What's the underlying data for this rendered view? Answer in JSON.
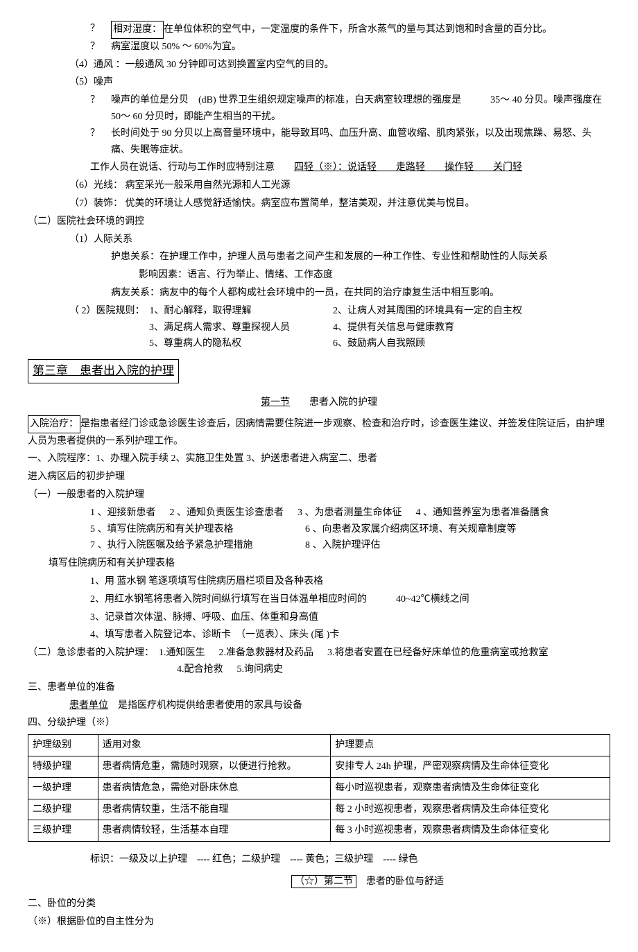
{
  "l1": {
    "q": "？",
    "label": "相对湿度：",
    "text": "在单位体积的空气中，一定温度的条件下，所含水蒸气的量与其达到饱和时含量的百分比。"
  },
  "l2": {
    "q": "？",
    "text": "病室湿度以 50% ～ 60%为宜。"
  },
  "l3": "（4）通风 ：一般通风 30 分钟即可达到换置室内空气的目的。",
  "l4": "（5）噪声",
  "l5": {
    "q": "？",
    "text": "噪声的单位是分贝　(dB) 世界卫生组织规定噪声的标准，白天病室较理想的强度是　　　35～ 40 分贝。噪声强度在 50～ 60 分贝时，即能产生相当的干扰。"
  },
  "l6": {
    "q": "？",
    "text": "长时间处于 90 分贝以上高音量环境中，能导致耳鸣、血压升高、血管收缩、肌肉紧张，以及出现焦躁、易怒、头痛、失眠等症状。"
  },
  "l7a": "工作人员在说话、行动与工作时应特别注意",
  "l7b": "四轻（※）：说话轻　　走路轻　　操作轻　　关门轻",
  "l8": "（6）光线：  病室采光一般采用自然光源和人工光源",
  "l9": "（7）装饰：  优美的环境让人感觉舒适愉快。病室应布置简单，整洁美观，并注意优美与悦目。",
  "l10": "（二）医院社会环境的调控",
  "l11": "（1）人际关系",
  "l12": "护患关系：在护理工作中，护理人员与患者之间产生和发展的一种工作性、专业性和帮助性的人际关系",
  "l13": "影响因素：语言、行为举止、情绪、工作态度",
  "l14": "病友关系：病友中的每个人都构成社会环境中的一员，在共同的治疗康复生活中相互影响。",
  "l15a": "（ 2）医院规则：　1、耐心解释，取得理解",
  "l15b": "2、让病人对其周围的环境具有一定的自主权",
  "l16a": "3、满足病人需求、尊重探视人员",
  "l16b": "4、提供有关信息与健康教育",
  "l17a": "5、尊重病人的隐私权",
  "l17b": "6、鼓励病人自我照顾",
  "chapter3": "第三章　患者出入院的护理",
  "sec1a": "第一节",
  "sec1b": "患者入院的护理",
  "l18a": "入院治疗：",
  "l18b": "是指患者经门诊或急诊医生诊查后，因病情需要住院进一步观察、检查和治疗时，诊查医生建议、并签发住院证后，由护理人员为患者提供的一系列护理工作。",
  "l19": "一、入院程序：1、办理入院手续 2、实施卫生处置 3、护送患者进入病室二、患者",
  "l19b": "进入病区后的初步护理",
  "l20": "（一）一般患者的入院护理",
  "l21": {
    "a": "1 、迎接新患者",
    "b": "2 、通知负责医生诊查患者",
    "c": "3 、为患者测量生命体征",
    "d": "4 、通知营养室为患者准备膳食"
  },
  "l22": {
    "a": "5 、填写住院病历和有关护理表格",
    "b": "6 、向患者及家属介绍病区环境、有关规章制度等"
  },
  "l23": {
    "a": "7 、执行入院医嘱及给予紧急护理措施",
    "b": "8 、入院护理评估"
  },
  "l24": "填写住院病历和有关护理表格",
  "l25": "1、用 蓝水钢 笔逐项填写住院病历眉栏项目及各种表格",
  "l26": "2、用红水钢笔将患者入院时间纵行填写在当日体温单相应时间的　　　40~42℃横线之间",
  "l27": "3、记录首次体温、脉搏、呼吸、血压、体重和身高值",
  "l28": "4、填写患者入院登记本、诊断卡　（一览表）、床头 (尾 )卡",
  "l29": {
    "a": "（二）急诊患者的入院护理：　1.通知医生",
    "b": "2.准备急救器材及药品",
    "c": "3.将患者安置在已经备好床单位的危重病室或抢救室"
  },
  "l30": {
    "a": "4.配合抢救",
    "b": "5.询问病史"
  },
  "l31": "三、患者单位的准备",
  "l32a": "患者单位",
  "l32b": "　是指医疗机构提供给患者使用的家具与设备",
  "l33": "四、分级护理（※）",
  "table": {
    "h1": "护理级别",
    "h2": "适用对象",
    "h3": "护理要点",
    "r1": {
      "c1": "特级护理",
      "c2": "患者病情危重，需随时观察，以便进行抢救。",
      "c3": "安排专人 24h 护理，严密观察病情及生命体征变化"
    },
    "r2": {
      "c1": "一级护理",
      "c2": "患者病情危急，需绝对卧床休息",
      "c3": "每小时巡视患者，观察患者病情及生命体征变化"
    },
    "r3": {
      "c1": "二级护理",
      "c2": "患者病情较重，生活不能自理",
      "c3": "每 2 小时巡视患者，观察患者病情及生命体征变化"
    },
    "r4": {
      "c1": "三级护理",
      "c2": "患者病情较轻，生活基本自理",
      "c3": "每 3 小时巡视患者，观察患者病情及生命体征变化"
    }
  },
  "l34": "标识：一级及以上护理　---- 红色；二级护理　---- 黄色；三级护理　---- 绿色",
  "sec2a": "（☆）第二节",
  "sec2b": "患者的卧位与舒适",
  "l35": "二、卧位的分类",
  "l36": "（※）根据卧位的自主性分为"
}
